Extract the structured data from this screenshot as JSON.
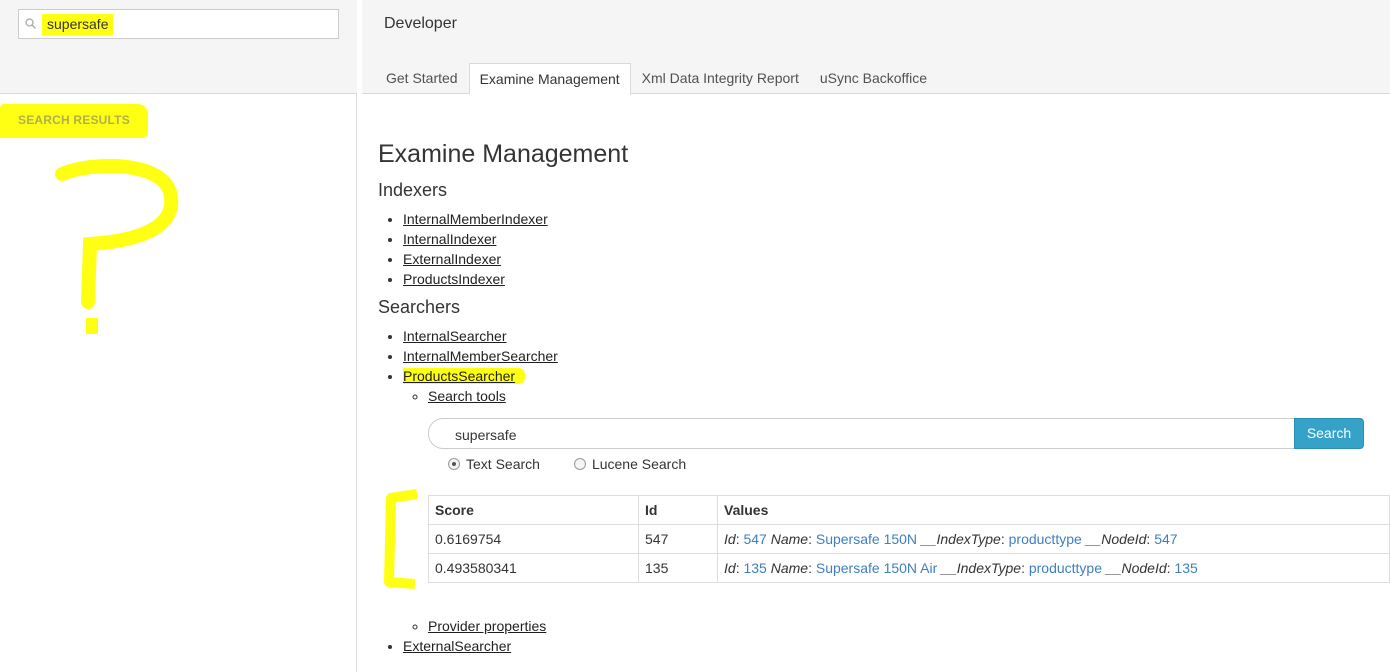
{
  "tree": {
    "search_value": "supersafe",
    "results_label": "SEARCH RESULTS"
  },
  "header": {
    "title": "Developer",
    "tabs": [
      {
        "label": "Get Started",
        "active": false
      },
      {
        "label": "Examine Management",
        "active": true
      },
      {
        "label": "Xml Data Integrity Report",
        "active": false
      },
      {
        "label": "uSync Backoffice",
        "active": false
      }
    ]
  },
  "main": {
    "title": "Examine Management",
    "indexers_heading": "Indexers",
    "indexers": [
      "InternalMemberIndexer",
      "InternalIndexer",
      "ExternalIndexer",
      "ProductsIndexer"
    ],
    "searchers_heading": "Searchers",
    "searchers": [
      "InternalSearcher",
      "InternalMemberSearcher",
      "ProductsSearcher"
    ],
    "last_searcher": "ExternalSearcher",
    "search_tools_link": "Search tools",
    "provider_properties_link": "Provider properties",
    "search": {
      "query": "supersafe",
      "button_label": "Search",
      "text_search_label": "Text Search",
      "lucene_search_label": "Lucene Search",
      "selected": "Text Search"
    },
    "results": {
      "headers": [
        "Score",
        "Id",
        "Values"
      ],
      "rows": [
        {
          "score": "0.6169754",
          "id": "547",
          "v_id_key": "Id",
          "v_id": "547",
          "v_name_key": "Name",
          "v_name": "Supersafe 150N",
          "v_type_key": "__IndexType",
          "v_type": "producttype",
          "v_node_key": "__NodeId",
          "v_node": "547"
        },
        {
          "score": "0.493580341",
          "id": "135",
          "v_id_key": "Id",
          "v_id": "135",
          "v_name_key": "Name",
          "v_name": "Supersafe 150N Air",
          "v_type_key": "__IndexType",
          "v_type": "producttype",
          "v_node_key": "__NodeId",
          "v_node": "135"
        }
      ]
    }
  },
  "colors": {
    "highlight": "#ffff14",
    "link_blue": "#3f7fbf",
    "button": "#35a3c8"
  }
}
